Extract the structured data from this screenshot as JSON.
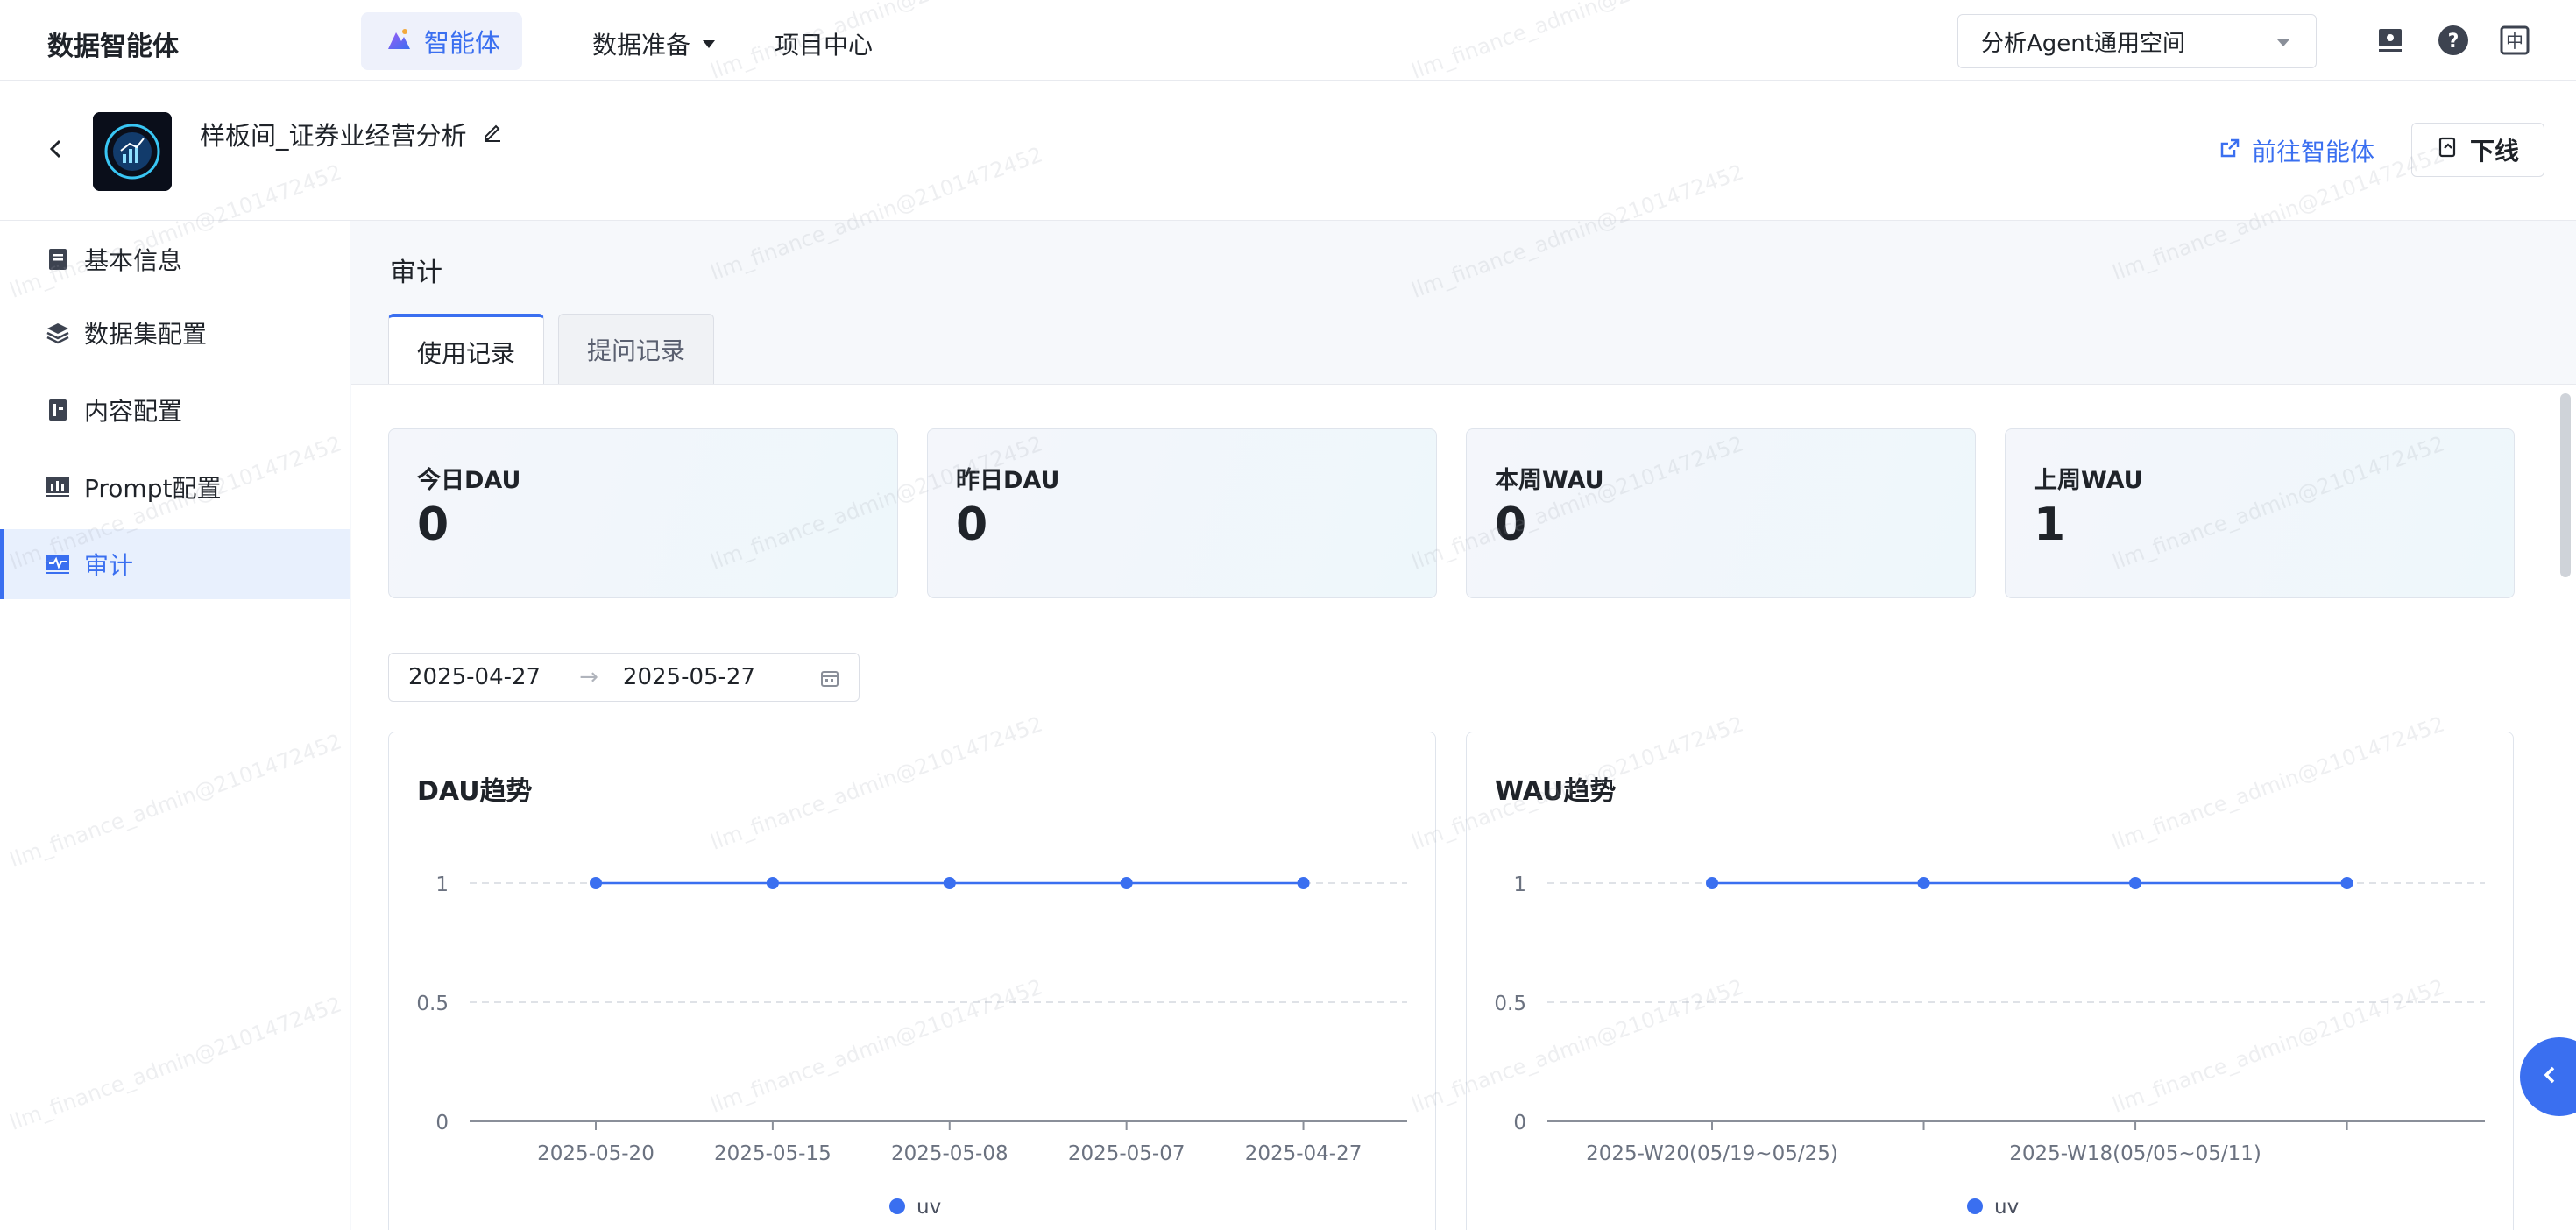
{
  "topnav": {
    "brand": "数据智能体",
    "agent_tab": "智能体",
    "data_prep": "数据准备",
    "project_center": "项目中心",
    "workspace": "分析Agent通用空间",
    "icons": [
      "monitor-icon",
      "help-icon",
      "language-icon"
    ],
    "lang_label": "中"
  },
  "subhead": {
    "title": "样板间_证券业经营分析",
    "goto_label": "前往智能体",
    "offline_label": "下线"
  },
  "sidebar": {
    "items": [
      {
        "label": "基本信息",
        "icon": "info-icon"
      },
      {
        "label": "数据集配置",
        "icon": "layers-icon"
      },
      {
        "label": "内容配置",
        "icon": "content-icon"
      },
      {
        "label": "Prompt配置",
        "icon": "chart-icon"
      },
      {
        "label": "审计",
        "icon": "monitor-icon",
        "active": true
      }
    ]
  },
  "main": {
    "section_title": "审计",
    "tabs": [
      {
        "label": "使用记录",
        "active": true
      },
      {
        "label": "提问记录",
        "active": false
      }
    ],
    "stats": [
      {
        "label": "今日DAU",
        "value": "0"
      },
      {
        "label": "昨日DAU",
        "value": "0"
      },
      {
        "label": "本周WAU",
        "value": "0"
      },
      {
        "label": "上周WAU",
        "value": "1"
      }
    ],
    "date_start": "2025-04-27",
    "date_end": "2025-05-27",
    "date_arrow": "→"
  },
  "chart_data": [
    {
      "type": "line",
      "title": "DAU趋势",
      "categories": [
        "2025-05-20",
        "2025-05-15",
        "2025-05-08",
        "2025-05-07",
        "2025-04-27"
      ],
      "series": [
        {
          "name": "uv",
          "values": [
            1,
            1,
            1,
            1,
            1
          ]
        }
      ],
      "yticks": [
        "1",
        "0.5",
        "0"
      ],
      "ylim": [
        0,
        1
      ],
      "grid": true,
      "legend": "bottom-center",
      "color": "#3a6ff0"
    },
    {
      "type": "line",
      "title": "WAU趋势",
      "categories": [
        "2025-W20(05/19~05/25)",
        "",
        "2025-W18(05/05~05/11)",
        ""
      ],
      "series": [
        {
          "name": "uv",
          "values": [
            1,
            1,
            1,
            1
          ]
        }
      ],
      "yticks": [
        "1",
        "0.5",
        "0"
      ],
      "ylim": [
        0,
        1
      ],
      "grid": true,
      "legend": "bottom-center",
      "color": "#3a6ff0"
    }
  ],
  "watermark": "llm_finance_admin@2101472452"
}
